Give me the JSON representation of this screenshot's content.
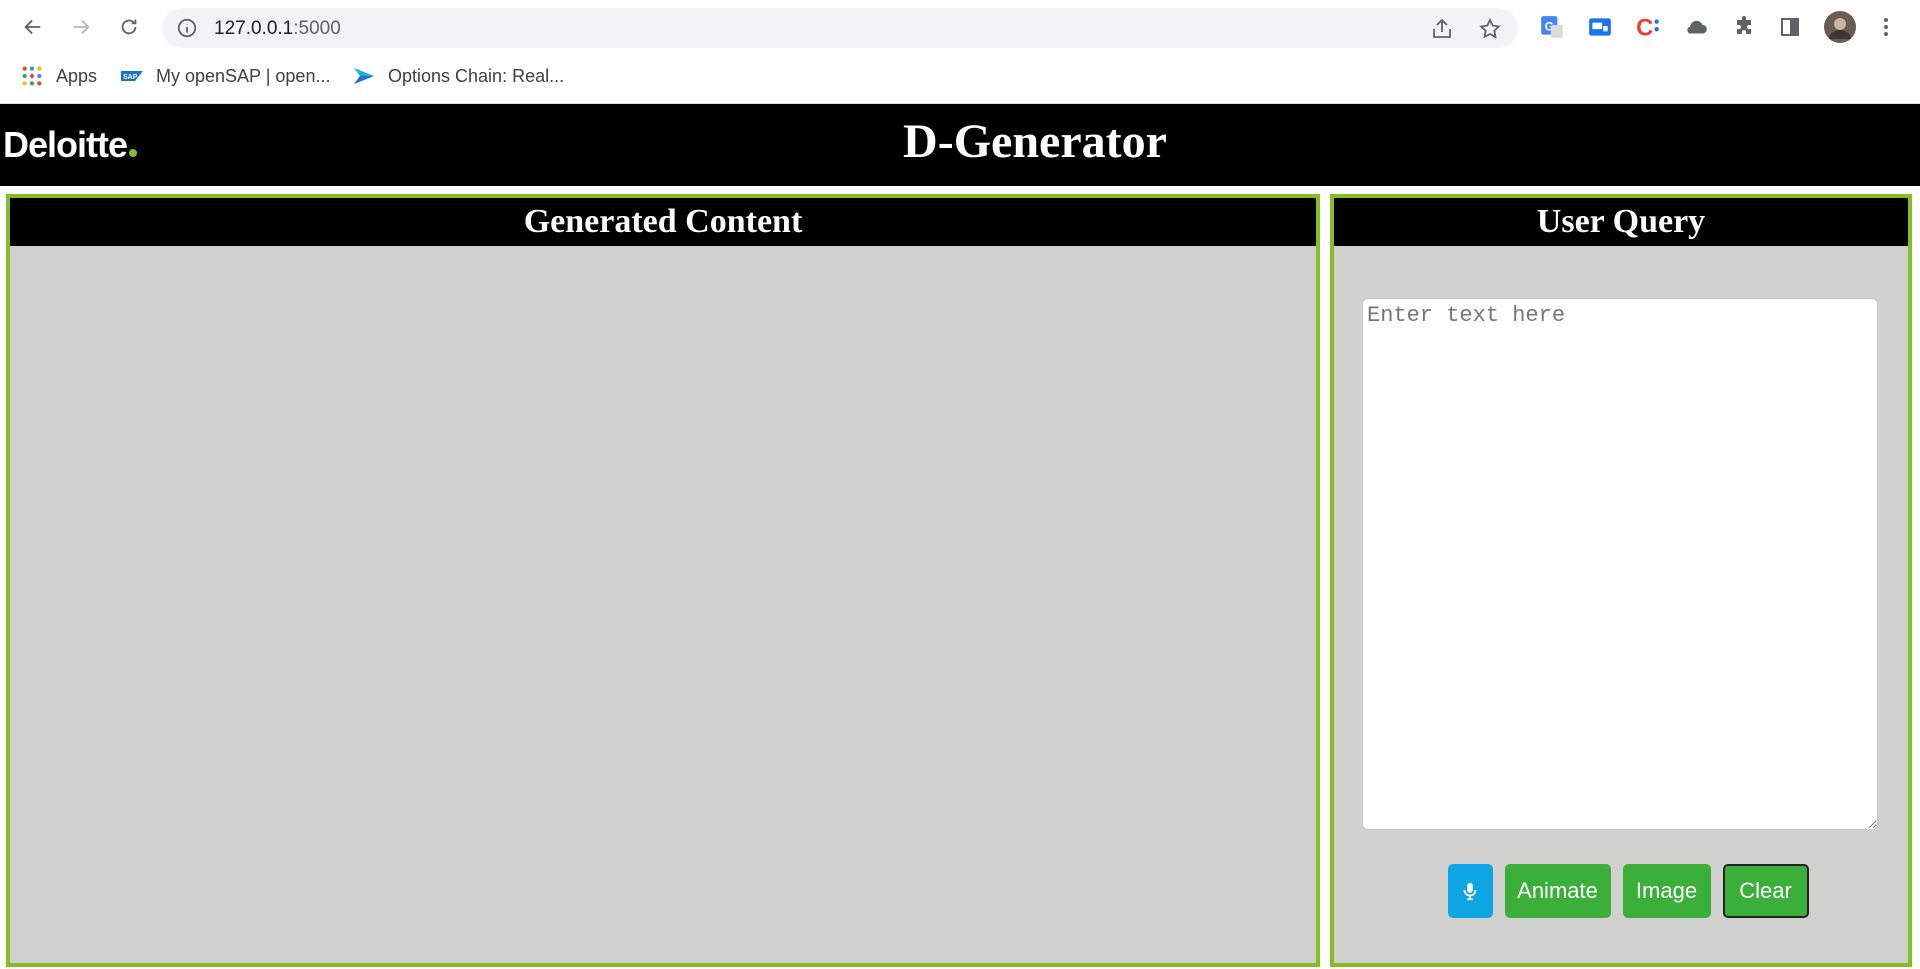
{
  "browser": {
    "url_host": "127.0.0.1",
    "url_port": ":5000",
    "bookmarks": [
      {
        "label": "Apps"
      },
      {
        "label": "My openSAP | open..."
      },
      {
        "label": "Options Chain: Real..."
      }
    ]
  },
  "header": {
    "logo": "Deloitte",
    "title": "D-Generator"
  },
  "panels": {
    "generated": {
      "title": "Generated Content"
    },
    "query": {
      "title": "User Query",
      "placeholder": "Enter text here",
      "value": ""
    }
  },
  "buttons": {
    "animate": "Animate",
    "image": "Image",
    "clear": "Clear"
  },
  "colors": {
    "accent_green": "#86bc25",
    "button_green": "#3ab03a",
    "mic_blue": "#0ea5e4",
    "panel_bg": "#d0d0ce"
  }
}
